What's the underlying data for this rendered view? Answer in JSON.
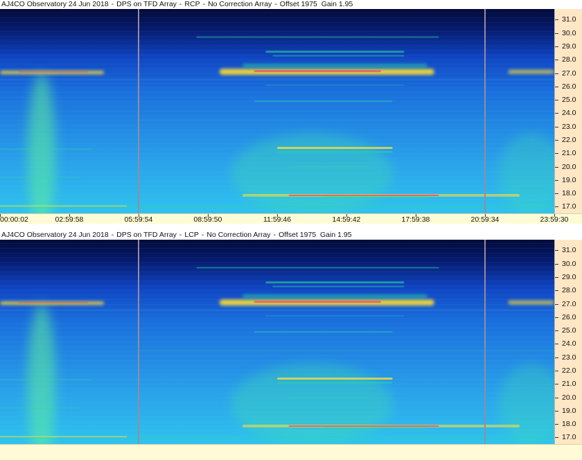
{
  "chart_data": [
    {
      "type": "heatmap",
      "title_parts": [
        "AJ4CO Observatory 24 Jun 2018",
        "-",
        "DPS on TFD Array",
        "-",
        "RCP",
        "-",
        "No Correction Array",
        "-",
        "Offset 1975",
        "Gain 1.95"
      ],
      "x_tick_labels": [
        "00:00:02",
        "02:59:58",
        "05:59:54",
        "08:59:50",
        "11:59:46",
        "14:59:42",
        "17:59:38",
        "20:59:34",
        "23:59:30"
      ],
      "y_tick_labels": [
        "31.0",
        "30.0",
        "29.0",
        "28.0",
        "27.0",
        "26.0",
        "25.0",
        "24.0",
        "23.0",
        "22.0",
        "21.0",
        "20.0",
        "19.0",
        "18.0",
        "17.0"
      ],
      "yrange_mhz": [
        16.5,
        31.8
      ],
      "y_ticks": [
        31,
        30,
        29,
        28,
        27,
        26,
        25,
        24,
        23,
        22,
        21,
        20,
        19,
        18,
        17
      ],
      "markers_hours": [
        6.0,
        21.0
      ],
      "colors": {
        "background": "#2a9de8",
        "high": "#ff2a6a",
        "mid": "#ffdd33",
        "low": "#2dd6a0",
        "quiet": "#061a6e"
      }
    },
    {
      "type": "heatmap",
      "title_parts": [
        "AJ4CO Observatory 24 Jun 2018",
        "-",
        "DPS on TFD Array",
        "-",
        "LCP",
        "-",
        "No Correction Array",
        "-",
        "Offset 1975",
        "Gain 1.95"
      ],
      "y_tick_labels": [
        "31.0",
        "30.0",
        "29.0",
        "28.0",
        "27.0",
        "26.0",
        "25.0",
        "24.0",
        "23.0",
        "22.0",
        "21.0",
        "20.0",
        "19.0",
        "18.0",
        "17.0"
      ],
      "yrange_mhz": [
        16.5,
        31.8
      ],
      "y_ticks": [
        31,
        30,
        29,
        28,
        27,
        26,
        25,
        24,
        23,
        22,
        21,
        20,
        19,
        18,
        17
      ],
      "markers_hours": [
        6.0,
        21.0
      ],
      "colors": {
        "background": "#2a9de8",
        "high": "#ff2a6a",
        "mid": "#ffdd33",
        "low": "#2dd6a0",
        "quiet": "#061a6e"
      }
    }
  ]
}
